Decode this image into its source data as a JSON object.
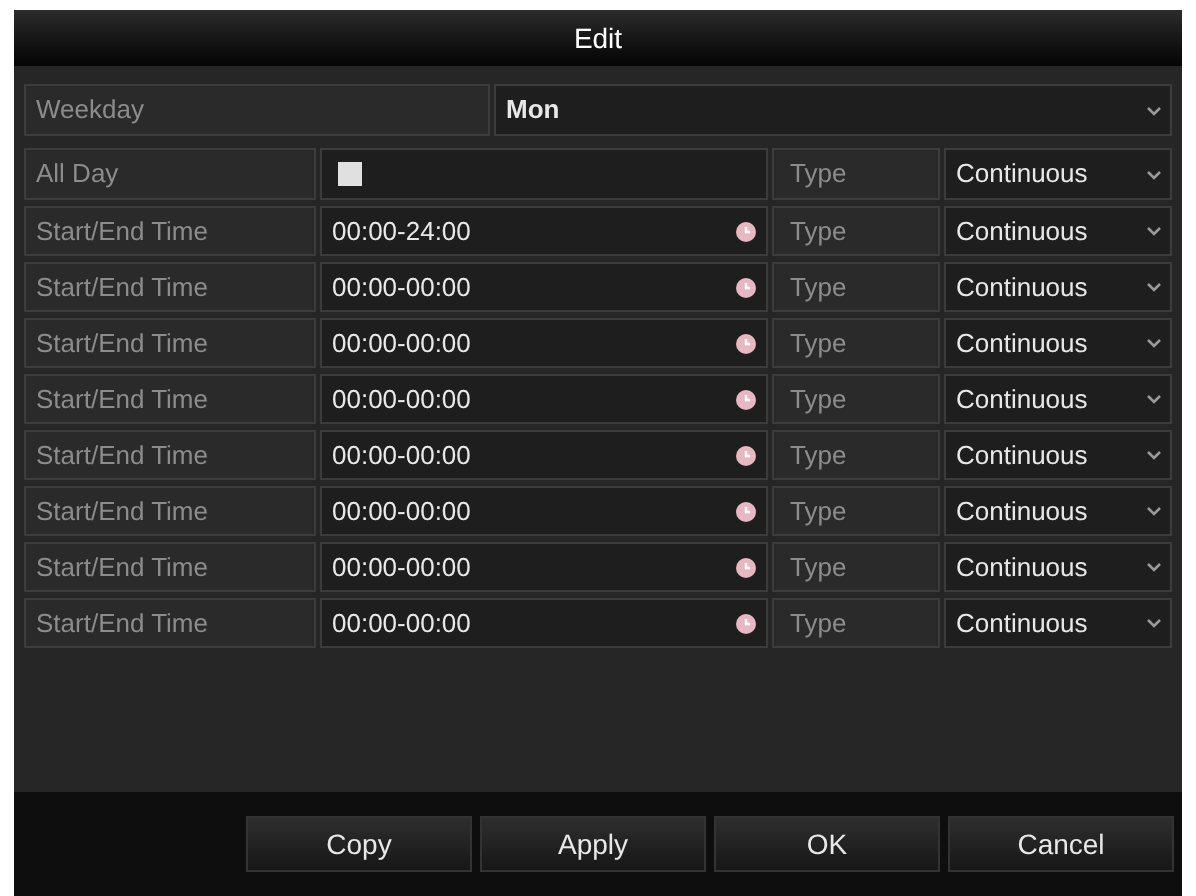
{
  "window": {
    "title": "Edit"
  },
  "weekday": {
    "label": "Weekday",
    "value": "Mon"
  },
  "all_day": {
    "label": "All Day",
    "checked": false,
    "type_label": "Type",
    "type_value": "Continuous"
  },
  "periods": [
    {
      "label": "Start/End Time",
      "time": "00:00-24:00",
      "type_label": "Type",
      "type_value": "Continuous"
    },
    {
      "label": "Start/End Time",
      "time": "00:00-00:00",
      "type_label": "Type",
      "type_value": "Continuous"
    },
    {
      "label": "Start/End Time",
      "time": "00:00-00:00",
      "type_label": "Type",
      "type_value": "Continuous"
    },
    {
      "label": "Start/End Time",
      "time": "00:00-00:00",
      "type_label": "Type",
      "type_value": "Continuous"
    },
    {
      "label": "Start/End Time",
      "time": "00:00-00:00",
      "type_label": "Type",
      "type_value": "Continuous"
    },
    {
      "label": "Start/End Time",
      "time": "00:00-00:00",
      "type_label": "Type",
      "type_value": "Continuous"
    },
    {
      "label": "Start/End Time",
      "time": "00:00-00:00",
      "type_label": "Type",
      "type_value": "Continuous"
    },
    {
      "label": "Start/End Time",
      "time": "00:00-00:00",
      "type_label": "Type",
      "type_value": "Continuous"
    }
  ],
  "buttons": [
    "Copy",
    "Apply",
    "OK",
    "Cancel"
  ]
}
